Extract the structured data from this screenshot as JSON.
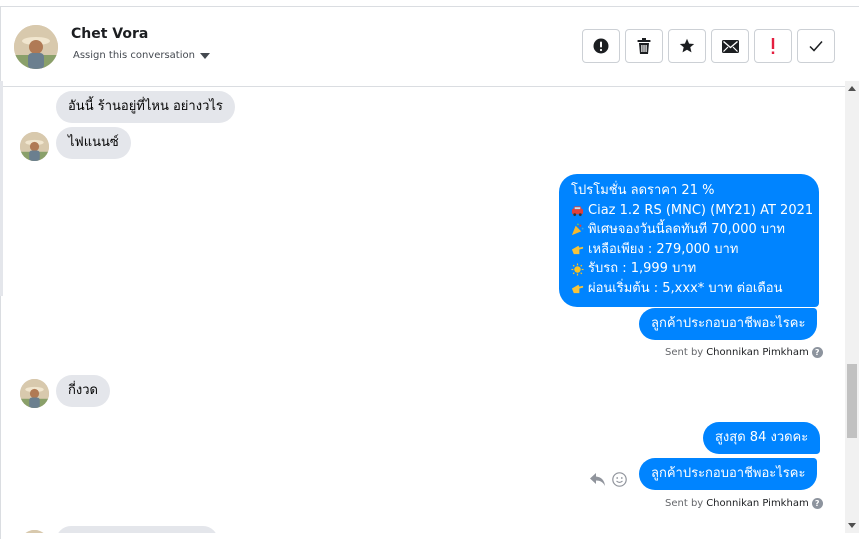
{
  "header": {
    "contact_name": "Chet Vora",
    "assign_label": "Assign this conversation"
  },
  "toolbar": {
    "buttons": [
      {
        "name": "mark-spam",
        "icon": "alert-circle-icon"
      },
      {
        "name": "delete",
        "icon": "trash-icon"
      },
      {
        "name": "star",
        "icon": "star-icon"
      },
      {
        "name": "mark-unread",
        "icon": "envelope-icon"
      },
      {
        "name": "priority",
        "icon": "exclamation-icon",
        "color": "#e41e3f"
      },
      {
        "name": "mark-done",
        "icon": "check-icon"
      }
    ]
  },
  "messages": {
    "in_1": "อันนี้ ร้านอยู่ที่ไหน อย่างวไร",
    "in_2": "ไฟแนนซ์",
    "promo": [
      {
        "emoji": "",
        "text": "โปรโมชั่น ลดราคา 21 %"
      },
      {
        "emoji": "car-emoji",
        "text": "Ciaz 1.2 RS (MNC) (MY21) AT 2021"
      },
      {
        "emoji": "party-popper-emoji",
        "text": "พิเศษจองวันนี้ลดทันที 70,000 บาท"
      },
      {
        "emoji": "pointing-hand-emoji",
        "text": "เหลือเพียง : 279,000 บาท"
      },
      {
        "emoji": "sun-emoji",
        "text": "รับรถ : 1,999 บาท"
      },
      {
        "emoji": "pointing-hand-emoji",
        "text": "ผ่อนเริ่มต้น : 5,xxx* บาท ต่อเดือน"
      }
    ],
    "out_1": "ลูกค้าประกอบอาชีพอะไรคะ",
    "sent_by_1": {
      "prefix": "Sent by",
      "name": "Chonnikan Pimkham",
      "help": "?"
    },
    "in_3": "กี่งวด",
    "out_2": "สูงสุด 84 งวดคะ",
    "out_3": "ลูกค้าประกอบอาชีพอะไรคะ",
    "sent_by_2": {
      "prefix": "Sent by",
      "name": "Chonnikan Pimkham",
      "help": "?"
    }
  },
  "colors": {
    "outgoing": "#0084ff",
    "incoming": "#e4e6eb"
  }
}
